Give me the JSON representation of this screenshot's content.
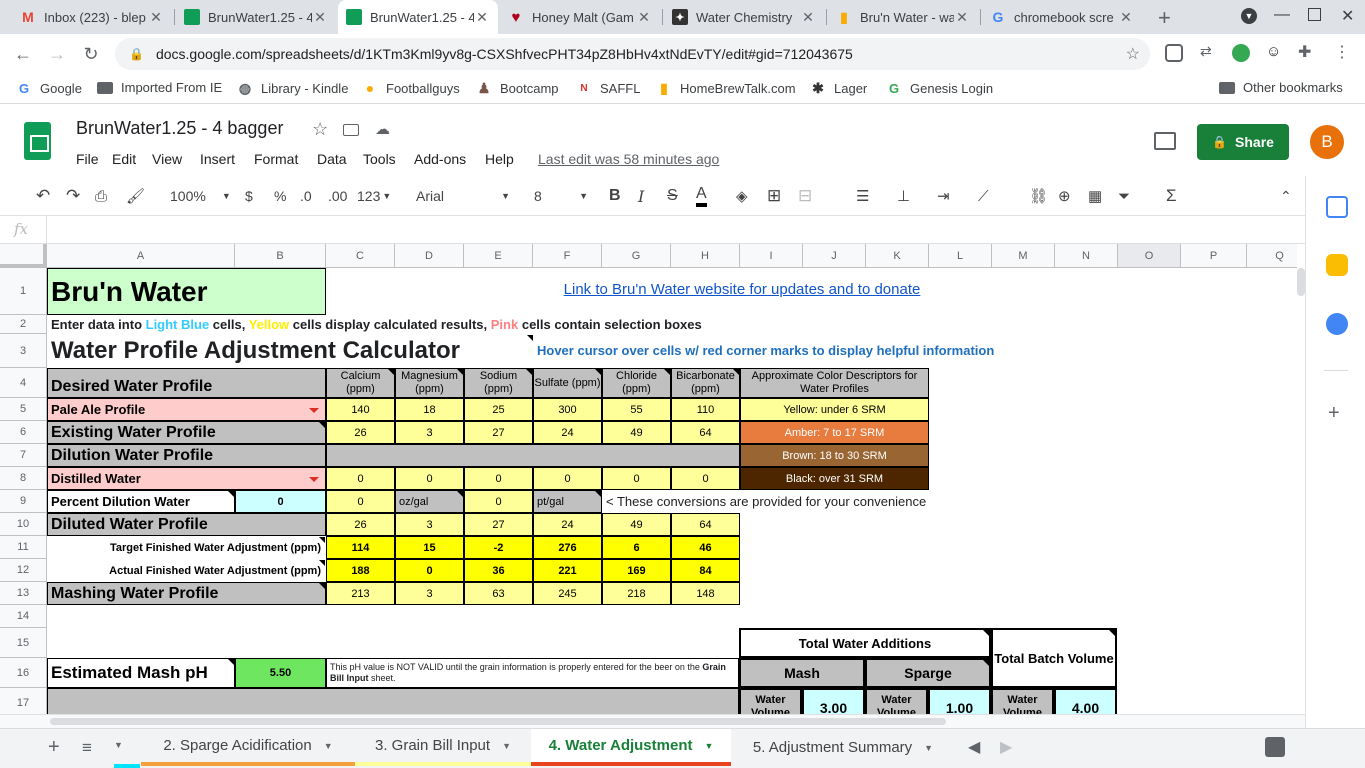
{
  "browser_tabs": [
    {
      "title": "Inbox (223) - blep",
      "color": "#ea4335",
      "icon": "gmail-icon",
      "glyph": "M"
    },
    {
      "title": "BrunWater1.25 - 4",
      "color": "#0f9d58",
      "icon": "sheets-icon",
      "glyph": ""
    },
    {
      "title": "BrunWater1.25 - 4",
      "color": "#0f9d58",
      "icon": "sheets-icon",
      "glyph": "",
      "active": true
    },
    {
      "title": "Honey Malt (Gam",
      "color": "#b00020",
      "icon": "heart-icon",
      "glyph": "♥"
    },
    {
      "title": "Water Chemistry",
      "color": "#333333",
      "icon": "atom-icon",
      "glyph": "✦"
    },
    {
      "title": "Bru'n Water - wat",
      "color": "#f9ab00",
      "icon": "beer-icon",
      "glyph": "▮"
    },
    {
      "title": "chromebook scre",
      "color": "#4285f4",
      "icon": "google-icon",
      "glyph": "G"
    }
  ],
  "address": {
    "url": "docs.google.com/spreadsheets/d/1KTm3Kml9yv8g-CSXShfvecPHT34pZ8HbHv4xtNdEvTY/edit#gid=712043675"
  },
  "bookmarks": [
    {
      "label": "Google",
      "icon": "google-icon",
      "glyph": "G",
      "color": "#4285f4"
    },
    {
      "label": "Imported From IE",
      "icon": "folder-icon",
      "glyph": "",
      "color": "#5f6368"
    },
    {
      "label": "Library - Kindle",
      "icon": "globe-icon",
      "glyph": "◍",
      "color": "#5f6368"
    },
    {
      "label": "Footballguys",
      "icon": "football-icon",
      "glyph": "●",
      "color": "#f9ab00"
    },
    {
      "label": "Bootcamp",
      "icon": "bootcamp-icon",
      "glyph": "♟",
      "color": "#795548"
    },
    {
      "label": "SAFFL",
      "icon": "nfl-icon",
      "glyph": "N",
      "color": "#d93025"
    },
    {
      "label": "HomeBrewTalk.com",
      "icon": "beer-icon",
      "glyph": "▮",
      "color": "#f9ab00"
    },
    {
      "label": "Lager",
      "icon": "hop-icon",
      "glyph": "✱",
      "color": "#333333"
    },
    {
      "label": "Genesis Login",
      "icon": "genesis-icon",
      "glyph": "G",
      "color": "#34a853"
    }
  ],
  "other_bookmarks": "Other bookmarks",
  "doc": {
    "title": "BrunWater1.25 - 4 bagger",
    "menus": [
      "File",
      "Edit",
      "View",
      "Insert",
      "Format",
      "Data",
      "Tools",
      "Add-ons",
      "Help"
    ],
    "last_edit": "Last edit was 58 minutes ago",
    "share": "Share",
    "avatar": "B"
  },
  "toolbar": {
    "zoom": "100%",
    "currency": "$",
    "percent": "%",
    "dec_less": ".0",
    "dec_more": ".00",
    "format": "123",
    "font": "Arial",
    "size": "8"
  },
  "formula": {
    "fx": "fx"
  },
  "columns": [
    "A",
    "B",
    "C",
    "D",
    "E",
    "F",
    "G",
    "H",
    "I",
    "J",
    "K",
    "L",
    "M",
    "N",
    "O",
    "P",
    "Q"
  ],
  "rows": [
    "1",
    "2",
    "3",
    "4",
    "5",
    "6",
    "7",
    "8",
    "9",
    "10",
    "11",
    "12",
    "13",
    "14",
    "15",
    "16",
    "17"
  ],
  "sheet": {
    "title": "Bru'n Water",
    "link": "Link to Bru'n Water website for updates and to donate",
    "instr_a": "Enter data into ",
    "instr_lb": "Light Blue",
    "instr_b": " cells, ",
    "instr_y": "Yellow",
    "instr_c": " cells display calculated results, ",
    "instr_p": "Pink",
    "instr_d": " cells contain selection boxes",
    "calc_title": "Water Profile Adjustment Calculator",
    "hover": "Hover cursor over cells w/ red corner marks to display helpful information",
    "ion_headers": [
      "Calcium (ppm)",
      "Magnesium (ppm)",
      "Sodium (ppm)",
      "Sulfate (ppm)",
      "Chloride (ppm)",
      "Bicarbonate (ppm)"
    ],
    "color_desc_header": "Approximate Color Descriptors for Water Profiles",
    "desired": "Desired Water Profile",
    "pale_ale": "Pale Ale Profile",
    "pale_vals": [
      "140",
      "18",
      "25",
      "300",
      "55",
      "110"
    ],
    "existing": "Existing Water Profile",
    "existing_vals": [
      "26",
      "3",
      "27",
      "24",
      "49",
      "64"
    ],
    "dilution": "Dilution Water Profile",
    "distilled": "Distilled Water",
    "distilled_vals": [
      "0",
      "0",
      "0",
      "0",
      "0",
      "0"
    ],
    "percent_dilution": "Percent Dilution Water",
    "percent_val": "0",
    "conv": [
      "0",
      "oz/gal",
      "0",
      "pt/gal"
    ],
    "conv_note": "< These conversions are provided for your convenience",
    "diluted": "Diluted Water Profile",
    "diluted_vals": [
      "26",
      "3",
      "27",
      "24",
      "49",
      "64"
    ],
    "target": "Target Finished Water Adjustment (ppm)",
    "target_vals": [
      "114",
      "15",
      "-2",
      "276",
      "6",
      "46"
    ],
    "actual": "Actual Finished Water Adjustment (ppm)",
    "actual_vals": [
      "188",
      "0",
      "36",
      "221",
      "169",
      "84"
    ],
    "mashing": "Mashing Water Profile",
    "mashing_vals": [
      "213",
      "3",
      "63",
      "245",
      "218",
      "148"
    ],
    "srm": [
      {
        "label": "Yellow: under 6 SRM",
        "color": "#ffff99",
        "text": "#000000"
      },
      {
        "label": "Amber: 7 to 17 SRM",
        "color": "#e87b3e",
        "text": "#ffffff"
      },
      {
        "label": "Brown: 18 to 30 SRM",
        "color": "#996633",
        "text": "#ffffff"
      },
      {
        "label": "Black: over 31 SRM",
        "color": "#4d2600",
        "text": "#ffffff"
      }
    ],
    "total_additions": "Total Water Additions",
    "total_batch": "Total Batch Volume",
    "mash": "Mash",
    "sparge": "Sparge",
    "est_ph": "Estimated Mash pH",
    "ph_val": "5.50",
    "ph_note_a": "This pH value is NOT VALID until the grain information is properly entered for the beer on the ",
    "ph_note_b": "Grain Bill Input",
    "ph_note_c": " sheet.",
    "water_volume": "Water Volume",
    "vol_mash": "3.00",
    "vol_sparge": "1.00",
    "vol_total": "4.00"
  },
  "sheet_tabs": [
    {
      "label": "2. Sparge Acidification",
      "color": "#f4a13c"
    },
    {
      "label": "3. Grain Bill Input",
      "color": "#ffff99"
    },
    {
      "label": "4. Water Adjustment",
      "color": "#e8431f",
      "active": true
    },
    {
      "label": "5. Adjustment Summary",
      "color": ""
    }
  ],
  "colors": {
    "accent": "#188038",
    "link": "#1155cc",
    "hover_text": "#1f6fbf"
  }
}
